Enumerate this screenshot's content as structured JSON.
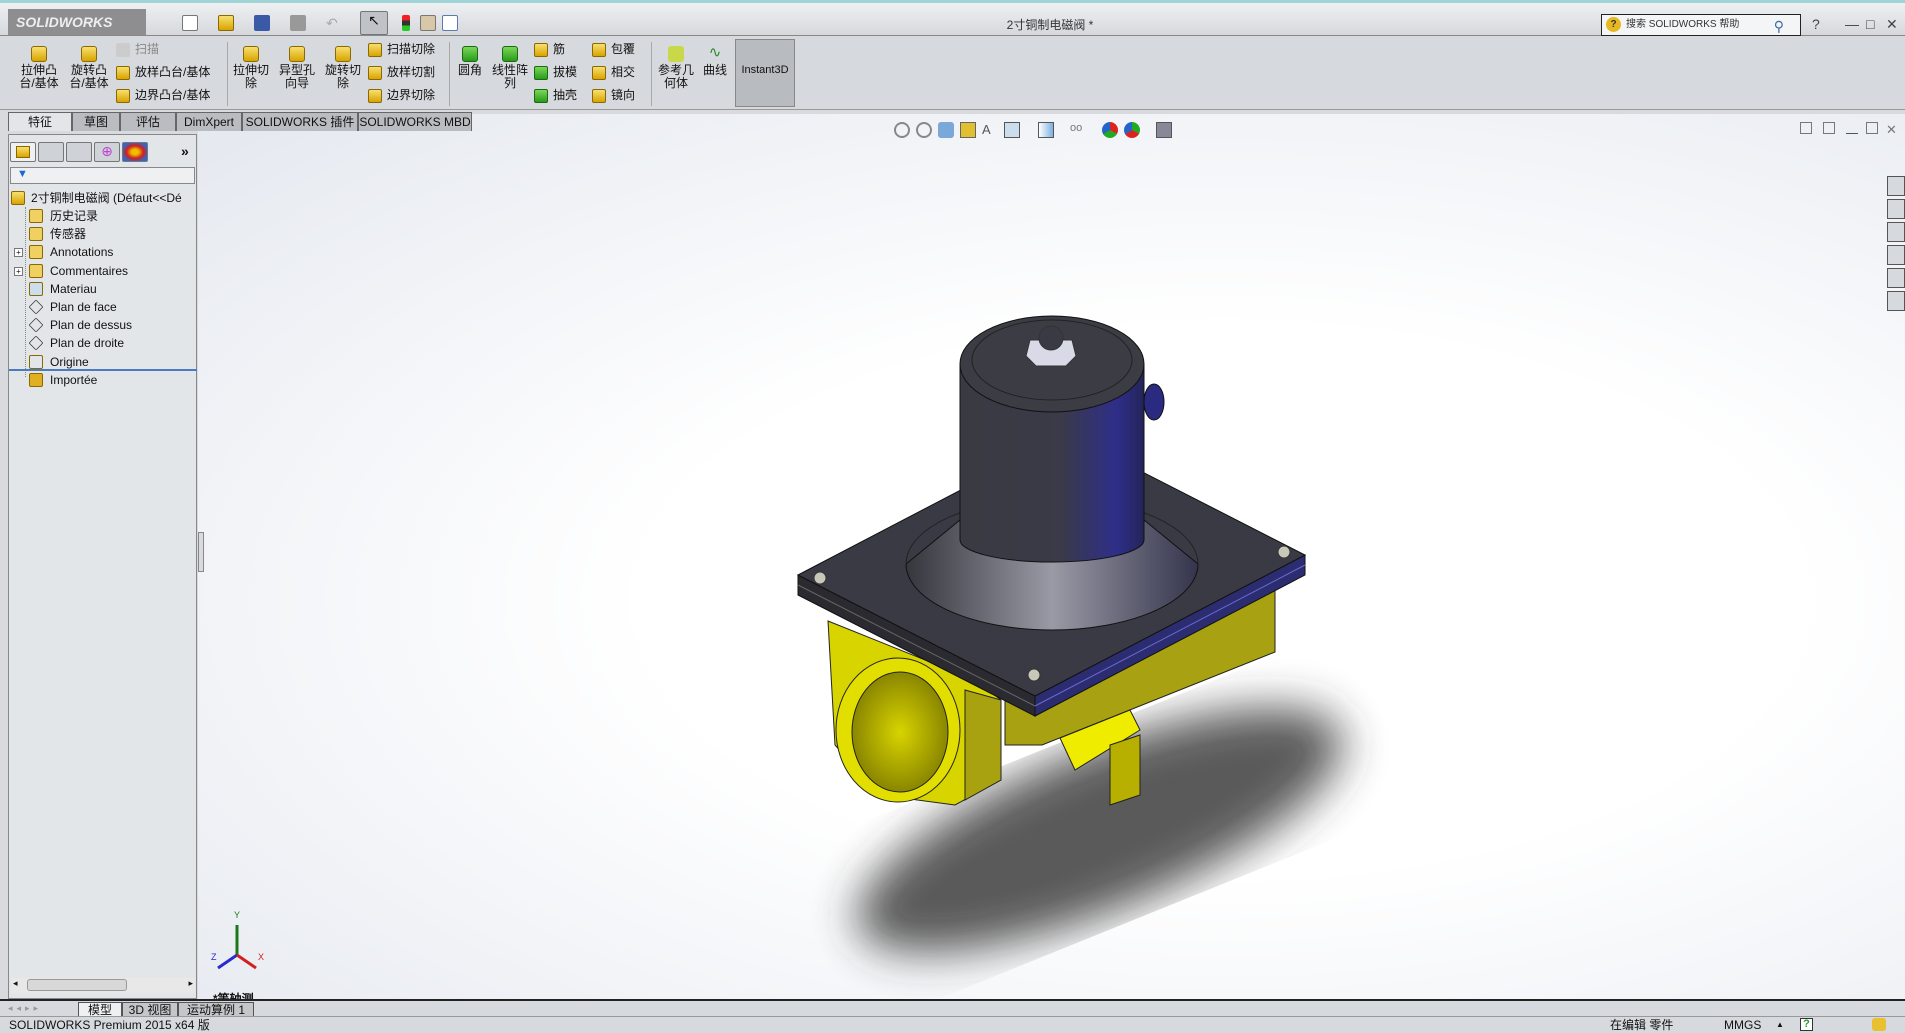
{
  "app": {
    "logo": "SOLIDWORKS",
    "title": "2寸铜制电磁阀 *"
  },
  "quick_access": [
    "new-icon",
    "open-icon",
    "save-icon",
    "print-icon",
    "undo-icon",
    "select-icon",
    "rebuild-icon",
    "file-properties-icon",
    "options-icon"
  ],
  "search": {
    "placeholder": "搜索 SOLIDWORKS 帮助"
  },
  "window_controls": {
    "help": "?",
    "minimize": "—",
    "maximize": "□",
    "close": "✕"
  },
  "command_manager": {
    "large": [
      {
        "label": "拉伸凸\n台/基体",
        "icon": "extrude-boss-icon"
      },
      {
        "label": "旋转凸\n台/基体",
        "icon": "revolve-boss-icon"
      },
      {
        "label": "拉伸切\n除",
        "icon": "extrude-cut-icon"
      },
      {
        "label": "异型孔\n向导",
        "icon": "hole-wizard-icon"
      },
      {
        "label": "旋转切\n除",
        "icon": "revolve-cut-icon"
      },
      {
        "label": "圆角",
        "icon": "fillet-icon"
      },
      {
        "label": "线性阵\n列",
        "icon": "linear-pattern-icon"
      },
      {
        "label": "参考几\n何体",
        "icon": "reference-geometry-icon"
      },
      {
        "label": "曲线",
        "icon": "curves-icon"
      }
    ],
    "boss_column": [
      "扫描",
      "放样凸台/基体",
      "边界凸台/基体"
    ],
    "cut_column": [
      "扫描切除",
      "放样切割",
      "边界切除"
    ],
    "feature_column1": [
      "筋",
      "拔模",
      "抽壳"
    ],
    "feature_column2": [
      "包覆",
      "相交",
      "镜向"
    ],
    "instant3d": "Instant3D"
  },
  "tabs": [
    "特征",
    "草图",
    "评估",
    "DimXpert",
    "SOLIDWORKS 插件",
    "SOLIDWORKS MBD"
  ],
  "active_tab": "特征",
  "tree": {
    "root": "2寸铜制电磁阀  (Défaut<<Dé",
    "items": [
      {
        "label": "历史记录",
        "icon": "history-icon",
        "expandable": false
      },
      {
        "label": "传感器",
        "icon": "sensors-icon",
        "expandable": false
      },
      {
        "label": "Annotations",
        "icon": "annotations-icon",
        "expandable": true
      },
      {
        "label": "Commentaires",
        "icon": "comments-icon",
        "expandable": true
      },
      {
        "label": "Materiau",
        "icon": "material-icon",
        "expandable": false
      },
      {
        "label": "Plan de face",
        "icon": "plane-icon",
        "expandable": false
      },
      {
        "label": "Plan de dessus",
        "icon": "plane-icon",
        "expandable": false
      },
      {
        "label": "Plan de droite",
        "icon": "plane-icon",
        "expandable": false
      },
      {
        "label": "Origine",
        "icon": "origin-icon",
        "expandable": false
      },
      {
        "label": "Importée",
        "icon": "imported-body-icon",
        "expandable": false
      }
    ]
  },
  "viewport": {
    "view_label": "*等轴测",
    "triad": {
      "x": "X",
      "y": "Y",
      "z": "Z"
    }
  },
  "bottom_tabs": [
    "模型",
    "3D 视图",
    "运动算例 1"
  ],
  "status": {
    "left": "SOLIDWORKS Premium 2015 x64 版",
    "mode": "在编辑 零件",
    "units": "MMGS"
  },
  "colors": {
    "body": "#e0dc00",
    "coil": "#3a3a44",
    "accent": "#2e3aa0"
  }
}
